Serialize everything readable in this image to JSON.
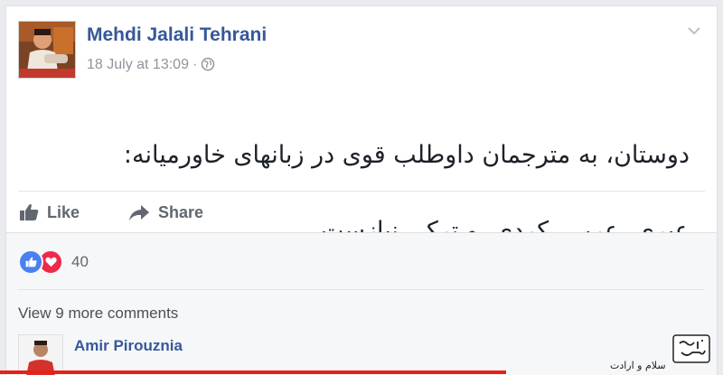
{
  "post": {
    "author_name": "Mehdi Jalali Tehrani",
    "timestamp": "18 July at 13:09",
    "separator": "·",
    "privacy_icon": "globe-icon",
    "menu_icon": "chevron-down-icon",
    "text_line1": "دوستان، به مترجمان داوطلب قوی در زبانهای خاورمیانه:",
    "text_line2": "عبری، عربی، کردی، و ترکی نیازست."
  },
  "actions": {
    "like_label": "Like",
    "share_label": "Share"
  },
  "reactions": {
    "icons": [
      "like-reaction-icon",
      "love-reaction-icon"
    ],
    "count": "40"
  },
  "comments": {
    "view_more_label": "View 9 more comments",
    "first_commenter": "Amir Pirouznia"
  },
  "overlay": {
    "caption": "سلام و ارادت"
  },
  "colors": {
    "link": "#365899",
    "meta": "#90949c",
    "like_blue": "#4a80f0",
    "love_red": "#f0284a",
    "progress_red": "#e62117"
  }
}
